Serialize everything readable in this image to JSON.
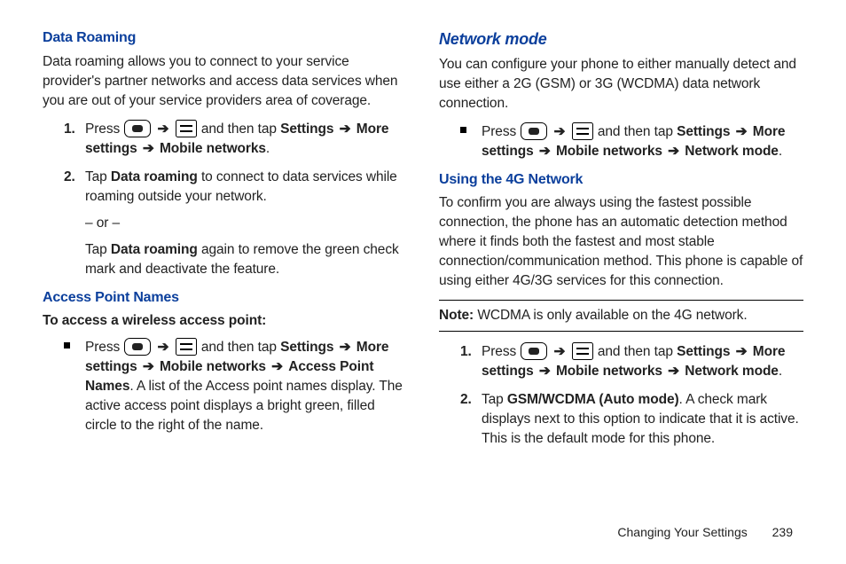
{
  "left": {
    "h_data_roaming": "Data Roaming",
    "data_roaming_body": "Data roaming allows you to connect to your service provider's partner networks and access data services when you are out of your service providers area of coverage.",
    "step1_marker": "1.",
    "step1_a": "Press ",
    "step1_b": " and then tap ",
    "step1_settings": "Settings",
    "step1_more": "More settings",
    "step1_mobile": "Mobile networks",
    "period": ".",
    "step2_marker": "2.",
    "step2_a": "Tap ",
    "step2_data_roaming": "Data roaming",
    "step2_b": " to connect to data services while roaming outside your network.",
    "or": "– or –",
    "step2_c": "Tap ",
    "step2_d": " again to remove the green check mark and deactivate the feature.",
    "h_apn": "Access Point Names",
    "apn_intro": "To access a wireless access point:",
    "apn_a": "Press ",
    "apn_b": " and then tap ",
    "apn_settings": "Settings",
    "apn_more": "More settings",
    "apn_mobile": "Mobile networks",
    "apn_names": "Access Point Names",
    "apn_tail": ". A list of the Access point names display. The active access point displays a bright green, filled circle to the right of the name."
  },
  "right": {
    "h_network_mode": "Network mode",
    "nm_body": "You can configure your phone to either manually detect and use either a 2G (GSM) or 3G (WCDMA) data network connection.",
    "nm_a": "Press ",
    "nm_b": " and then tap ",
    "nm_settings": "Settings",
    "nm_more": "More settings",
    "nm_mobile": "Mobile networks",
    "nm_mode": "Network mode",
    "period": ".",
    "h_4g": "Using the 4G Network",
    "fourg_body": "To confirm you are always using the fastest possible connection, the phone has an automatic detection method where it finds both the fastest and most stable connection/communication method. This phone is capable of using either 4G/3G services for this connection.",
    "note_label": "Note:",
    "note_body": " WCDMA is only available on the 4G network.",
    "s1_marker": "1.",
    "s1_a": "Press ",
    "s1_b": " and then tap ",
    "s1_settings": "Settings",
    "s1_more": "More settings",
    "s1_mobile": "Mobile networks",
    "s1_mode": "Network mode",
    "s2_marker": "2.",
    "s2_a": "Tap ",
    "s2_gsm": "GSM/WCDMA (Auto mode)",
    "s2_b": ". A check mark displays next to this option to indicate that it is active. This is the default mode for this phone."
  },
  "arrow": "➔",
  "footer": {
    "section": "Changing Your Settings",
    "page": "239"
  }
}
